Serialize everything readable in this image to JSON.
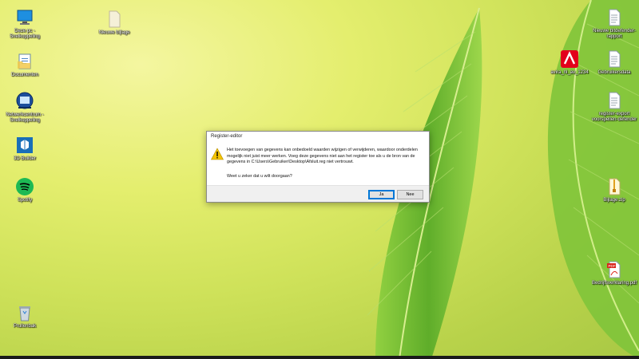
{
  "desktop": {
    "icons_left": [
      {
        "label": "Deze pc - Snelkoppeling",
        "icon": "computer-icon"
      },
      {
        "label": "Documenten",
        "icon": "documents-folder-icon"
      },
      {
        "label": "Netwerkcentrum - Snelkoppeling",
        "icon": "network-center-icon"
      },
      {
        "label": "3D Builder",
        "icon": "3d-builder-icon"
      },
      {
        "label": "Spotify",
        "icon": "spotify-icon"
      },
      {
        "label": "Prullenbak",
        "icon": "recycle-bin-icon"
      }
    ],
    "icon_mid": {
      "label": "Nieuwe bijlage",
      "icon": "blank-file-icon"
    },
    "icons_right": [
      {
        "label": "Nieuwe bitdefender-rapport",
        "icon": "text-file-icon"
      },
      {
        "label": "avira_nl_av_1234",
        "icon": "avira-icon"
      },
      {
        "label": "Gebruikersdata",
        "icon": "text-file-icon"
      },
      {
        "label": "register-export voorspellen-defender",
        "icon": "text-file-icon"
      },
      {
        "label": "Bijlage.zip",
        "icon": "zip-file-icon"
      },
      {
        "label": "Bedrijfsverklaring.pdf",
        "icon": "pdf-file-icon"
      }
    ]
  },
  "dialog": {
    "title": "Register-editor",
    "message": "Het toevoegen van gegevens kan onbedoeld waarden wijzigen of verwijderen, waardoor onderdelen mogelijk niet juist meer werken. Voeg deze gegevens niet aan het register toe als u de bron van de gegevens in C:\\Users\\Gebruiker\\Desktop\\Afsluit.reg niet vertrouwt.",
    "question": "Weet u zeker dat u wilt doorgaan?",
    "yes_label": "Ja",
    "no_label": "Nee",
    "icon": "warning-icon"
  },
  "colors": {
    "wallpaper": "#d6e65e",
    "leaf": "#6cb832",
    "taskbar": "#1a1a1a",
    "dialog_focus": "#0078d7",
    "warning": "#f5c400"
  }
}
